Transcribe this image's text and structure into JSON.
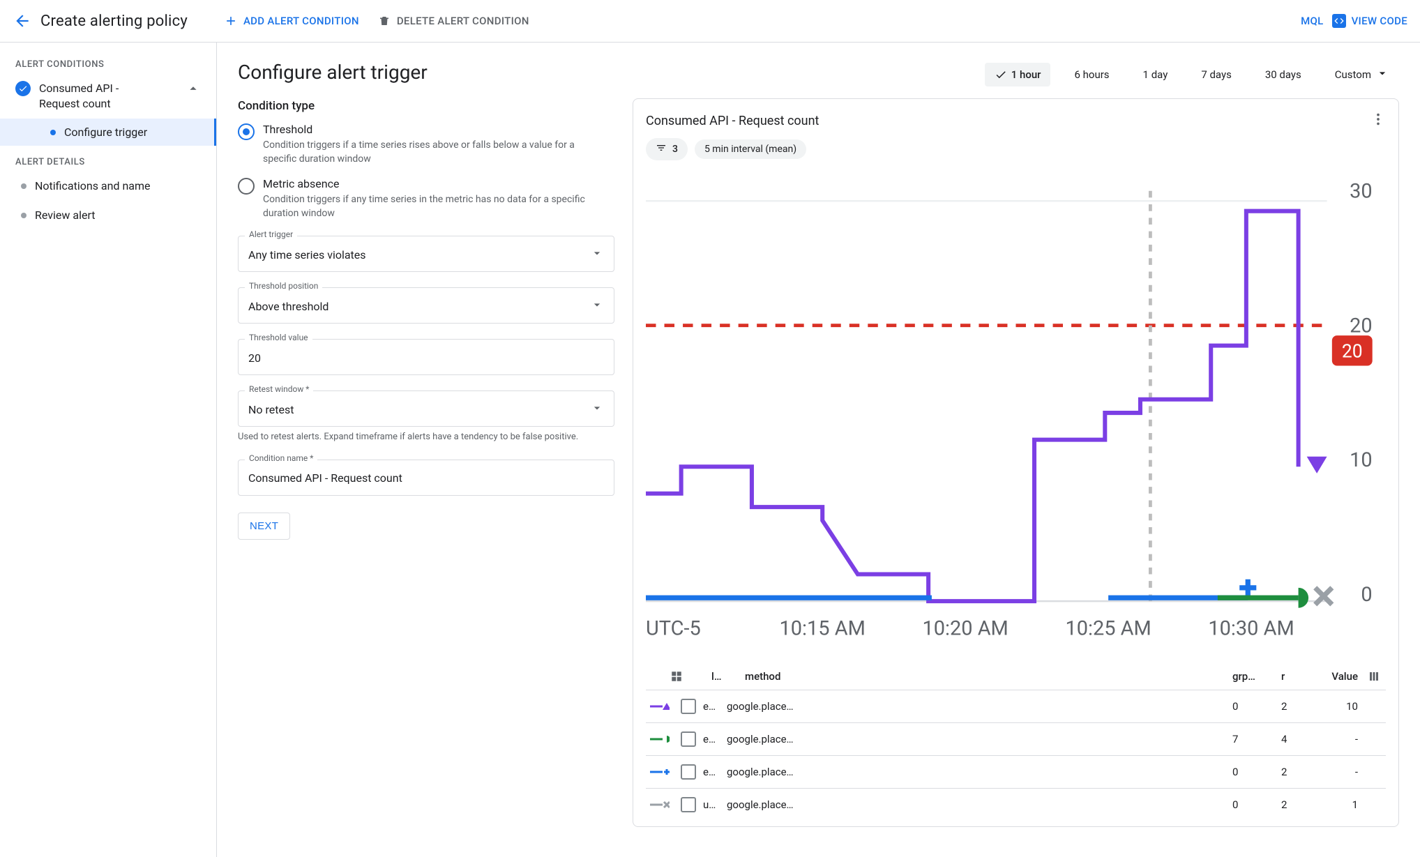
{
  "topbar": {
    "title": "Create alerting policy",
    "add_label": "ADD ALERT CONDITION",
    "delete_label": "DELETE ALERT CONDITION",
    "mql_label": "MQL",
    "view_code_label": "VIEW CODE"
  },
  "sidebar": {
    "h1": "ALERT CONDITIONS",
    "cond_title": "Consumed API - Request count",
    "sub1": "Configure trigger",
    "h2": "ALERT DETAILS",
    "item2": "Notifications and name",
    "item3": "Review alert"
  },
  "page": {
    "heading": "Configure alert trigger",
    "section_condition_type": "Condition type",
    "threshold": {
      "title": "Threshold",
      "desc": "Condition triggers if a time series rises above or falls below a value for a specific duration window"
    },
    "absence": {
      "title": "Metric absence",
      "desc": "Condition triggers if any time series in the metric has no data for a specific duration window"
    },
    "fields": {
      "alert_trigger": {
        "label": "Alert trigger",
        "value": "Any time series violates"
      },
      "threshold_position": {
        "label": "Threshold position",
        "value": "Above threshold"
      },
      "threshold_value": {
        "label": "Threshold value",
        "value": "20"
      },
      "retest": {
        "label": "Retest window *",
        "value": "No retest",
        "helper": "Used to retest alerts. Expand timeframe if alerts have a tendency to be false positive."
      },
      "condition_name": {
        "label": "Condition name *",
        "value": "Consumed API - Request count"
      }
    },
    "next": "NEXT"
  },
  "ranges": {
    "options": [
      "1 hour",
      "6 hours",
      "1 day",
      "7 days",
      "30 days",
      "Custom"
    ],
    "active": "1 hour"
  },
  "panel": {
    "title": "Consumed API - Request count",
    "filter_count": "3",
    "interval_chip": "5 min interval (mean)",
    "threshold_badge": "20",
    "timezone": "UTC-5",
    "yticks": [
      "0",
      "10",
      "20",
      "30"
    ],
    "xticks": [
      "10:15 AM",
      "10:20 AM",
      "10:25 AM",
      "10:30 AM"
    ],
    "columns": {
      "l": "l…",
      "method": "method",
      "grp": "grp…",
      "r": "r",
      "value": "Value"
    },
    "rows": [
      {
        "marker": "purple-tri",
        "e": "e…",
        "method": "google.place…",
        "grp": "0",
        "r": "2",
        "value": "10"
      },
      {
        "marker": "green-pent",
        "e": "e…",
        "method": "google.place…",
        "grp": "7",
        "r": "4",
        "value": "-"
      },
      {
        "marker": "blue-plus",
        "e": "e…",
        "method": "google.place…",
        "grp": "0",
        "r": "2",
        "value": "-"
      },
      {
        "marker": "gray-x",
        "e": "u…",
        "method": "google.place…",
        "grp": "0",
        "r": "2",
        "value": "1"
      }
    ]
  },
  "chart_data": {
    "type": "line",
    "title": "Consumed API - Request count",
    "ylabel": "",
    "xlabel": "",
    "ylim": [
      0,
      30
    ],
    "timezone": "UTC-5",
    "threshold": 20,
    "x": [
      "10:12",
      "10:13",
      "10:14",
      "10:15",
      "10:16",
      "10:17",
      "10:18",
      "10:19",
      "10:20",
      "10:21",
      "10:22",
      "10:23",
      "10:24",
      "10:25",
      "10:26",
      "10:27",
      "10:28",
      "10:29",
      "10:30",
      "10:31"
    ],
    "series": [
      {
        "name": "e… google.place… (purple)",
        "color": "#7b3fe4",
        "values": [
          8,
          8,
          10,
          10,
          7,
          7,
          6,
          2,
          2,
          0,
          0,
          0,
          12,
          12,
          14,
          15,
          15,
          19,
          29,
          29
        ]
      },
      {
        "name": "e… google.place… (blue)",
        "color": "#1a73e8",
        "values": [
          0,
          0,
          0,
          0,
          0,
          0,
          0,
          0,
          0,
          null,
          null,
          null,
          null,
          null,
          null,
          0,
          0,
          0,
          0,
          null
        ]
      },
      {
        "name": "e… google.place… (green)",
        "color": "#1e8e3e",
        "values": [
          null,
          null,
          null,
          null,
          null,
          null,
          null,
          null,
          null,
          null,
          null,
          null,
          null,
          null,
          null,
          null,
          0,
          0,
          0,
          null
        ]
      },
      {
        "name": "u… google.place… (gray)",
        "color": "#9aa0a6",
        "values": [
          null,
          null,
          null,
          null,
          null,
          null,
          null,
          null,
          null,
          null,
          null,
          null,
          null,
          null,
          null,
          null,
          null,
          null,
          0,
          null
        ]
      }
    ]
  }
}
